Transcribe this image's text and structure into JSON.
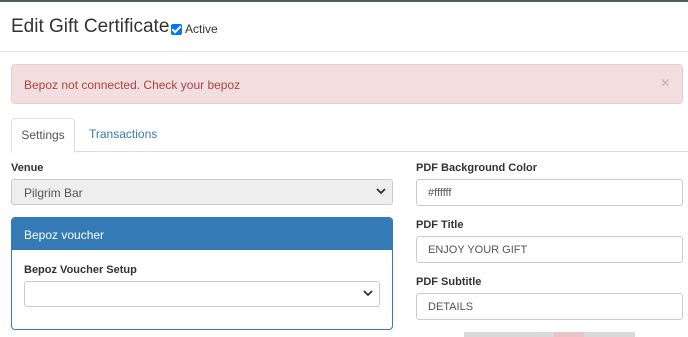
{
  "header": {
    "title": "Edit Gift Certificate",
    "active_label": "Active",
    "active_checked": true
  },
  "alert": {
    "message": "Bepoz not connected. Check your bepoz",
    "close_glyph": "×"
  },
  "tabs": [
    {
      "label": "Settings",
      "selected": true
    },
    {
      "label": "Transactions",
      "selected": false
    }
  ],
  "venue": {
    "label": "Venue",
    "value": "Pilgrim Bar"
  },
  "bepoz_panel": {
    "title": "Bepoz voucher",
    "setup_label": "Bepoz Voucher Setup",
    "setup_value": ""
  },
  "pdf": {
    "background_label": "PDF Background Color",
    "background_value": "#ffffff",
    "title_label": "PDF Title",
    "title_value": "ENJOY YOUR GIFT",
    "subtitle_label": "PDF Subtitle",
    "subtitle_value": "DETAILS"
  },
  "colors": {
    "primary": "#337ab7",
    "alert_bg": "#f2dede",
    "alert_text": "#a94442"
  }
}
